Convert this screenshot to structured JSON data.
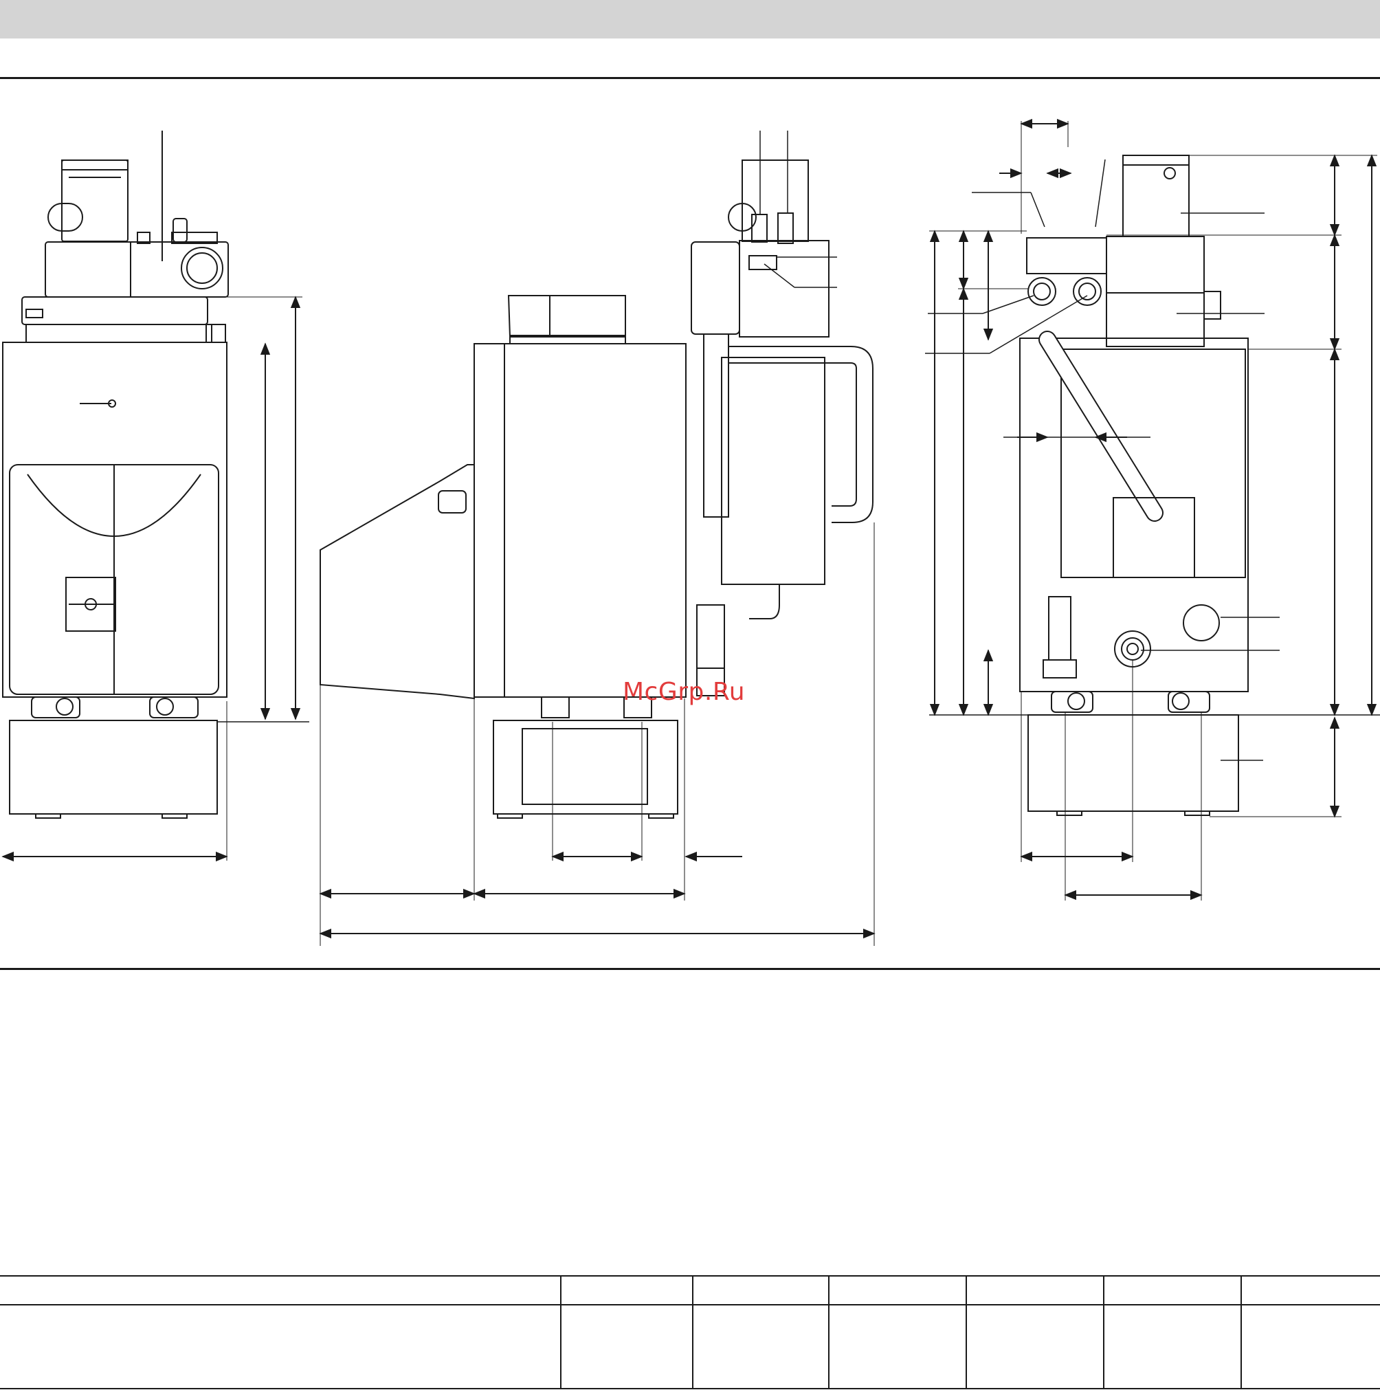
{
  "watermark": {
    "text": "McGrp.Ru"
  },
  "views": {
    "front": {
      "label": ""
    },
    "side": {
      "label": ""
    },
    "rear": {
      "label": ""
    }
  },
  "table": {
    "columns": 7,
    "rows": 1,
    "header": [
      "",
      "",
      "",
      "",
      "",
      "",
      ""
    ],
    "cells": [
      [
        "",
        "",
        "",
        "",
        "",
        "",
        ""
      ]
    ]
  },
  "colors": {
    "line": "#1a1a1a",
    "band": "#d4d4d4",
    "watermark": "#e23c3c"
  }
}
